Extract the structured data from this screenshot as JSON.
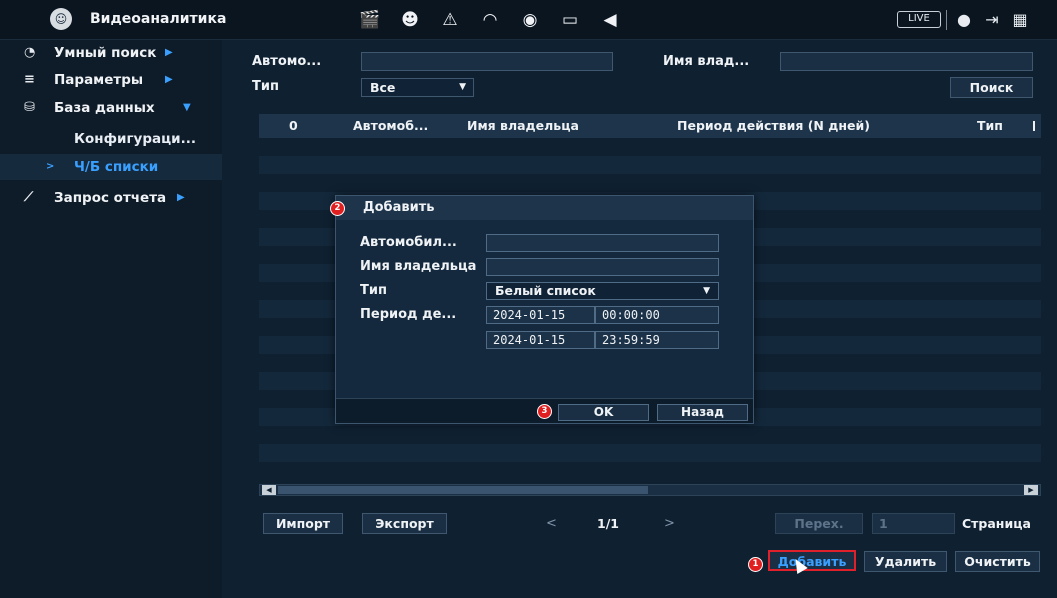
{
  "header": {
    "title": "Видеоаналитика",
    "live": "LIVE",
    "icons": [
      "camera-clapper-icon",
      "face-icon",
      "alarm-light-icon",
      "speedometer-icon",
      "target-icon",
      "monitor-icon",
      "speaker-icon"
    ]
  },
  "sidebar": {
    "items": [
      {
        "label": "Умный поиск",
        "icon": "smart-search-icon"
      },
      {
        "label": "Параметры",
        "icon": "list-icon"
      },
      {
        "label": "База данных",
        "icon": "database-icon"
      },
      {
        "label": "Конфигураци..."
      },
      {
        "label": "Ч/Б списки",
        "active": true
      },
      {
        "label": "Запрос отчета",
        "icon": "chart-icon"
      }
    ]
  },
  "filters": {
    "plate_label": "Автомо...",
    "owner_label": "Имя влад...",
    "type_label": "Тип",
    "type_value": "Все",
    "search_button": "Поиск"
  },
  "table": {
    "columns": [
      "0",
      "Автомоб...",
      "Имя владельца",
      "Период действия (N дней)",
      "Тип"
    ]
  },
  "dialog": {
    "title": "Добавить",
    "plate_label": "Автомобил...",
    "owner_label": "Имя владельца",
    "type_label": "Тип",
    "type_value": "Белый список",
    "period_label": "Период де...",
    "start_date": "2024-01-15",
    "start_time": "00:00:00",
    "end_date": "2024-01-15",
    "end_time": "23:59:59",
    "ok": "OK",
    "back": "Назад"
  },
  "pager": {
    "import": "Импорт",
    "export": "Экспорт",
    "prev": "<",
    "page": "1/1",
    "next": ">",
    "goto": "Перех.",
    "page_input": "1",
    "page_label": "Страница"
  },
  "actions": {
    "add": "Добавить",
    "delete": "Удалить",
    "clear": "Очистить"
  },
  "markers": [
    "1",
    "2",
    "3"
  ],
  "colors": {
    "accent": "#3aa0ff",
    "highlight": "#e0202a",
    "marker": "#e02020"
  }
}
